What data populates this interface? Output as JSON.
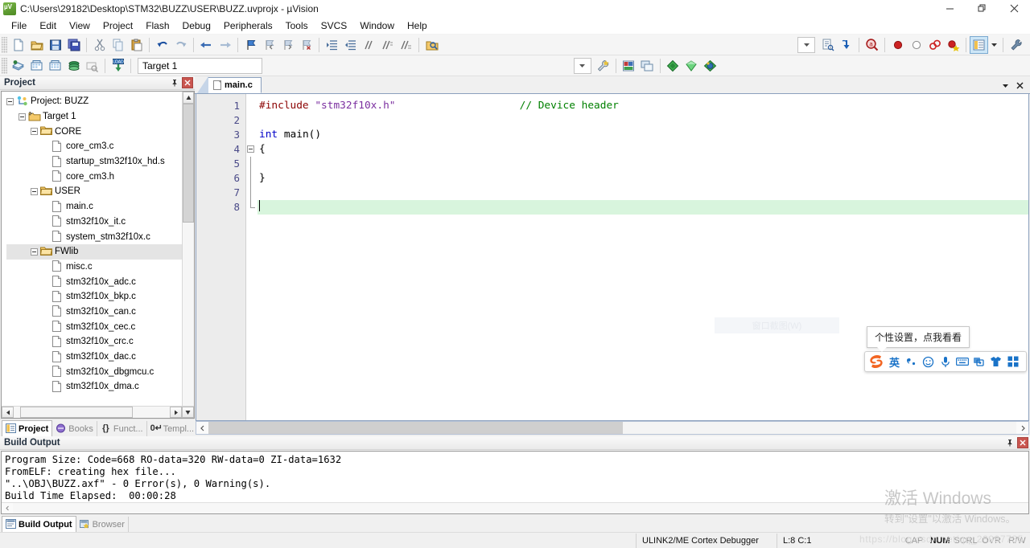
{
  "window": {
    "title": "C:\\Users\\29182\\Desktop\\STM32\\BUZZ\\USER\\BUZZ.uvprojx - µVision",
    "app_icon": "uvision-icon",
    "minimize": "–",
    "maximize": "❐",
    "close": "✕"
  },
  "menu": {
    "items": [
      {
        "label": "File"
      },
      {
        "label": "Edit"
      },
      {
        "label": "View"
      },
      {
        "label": "Project"
      },
      {
        "label": "Flash"
      },
      {
        "label": "Debug"
      },
      {
        "label": "Peripherals"
      },
      {
        "label": "Tools"
      },
      {
        "label": "SVCS"
      },
      {
        "label": "Window"
      },
      {
        "label": "Help"
      }
    ]
  },
  "toolbar_file": {
    "buttons": [
      {
        "name": "new-file-icon",
        "tip": "New"
      },
      {
        "name": "open-file-icon",
        "tip": "Open"
      },
      {
        "name": "save-icon",
        "tip": "Save"
      },
      {
        "name": "save-all-icon",
        "tip": "Save All"
      },
      {
        "name": "cut-icon",
        "tip": "Cut"
      },
      {
        "name": "copy-icon",
        "tip": "Copy"
      },
      {
        "name": "paste-icon",
        "tip": "Paste"
      },
      {
        "name": "undo-icon",
        "tip": "Undo"
      },
      {
        "name": "redo-icon",
        "tip": "Redo"
      },
      {
        "name": "back-arrow-icon",
        "tip": "Navigate Backwards"
      },
      {
        "name": "forward-arrow-icon",
        "tip": "Navigate Forwards"
      },
      {
        "name": "bookmark-toggle-icon",
        "tip": "Insert/Remove Bookmark"
      },
      {
        "name": "bookmark-prev-icon",
        "tip": "Previous Bookmark"
      },
      {
        "name": "bookmark-next-icon",
        "tip": "Next Bookmark"
      },
      {
        "name": "bookmark-clear-icon",
        "tip": "Clear All Bookmarks"
      },
      {
        "name": "indent-icon",
        "tip": "Indent"
      },
      {
        "name": "outdent-icon",
        "tip": "Outdent"
      },
      {
        "name": "comment-icon",
        "tip": "Comment"
      },
      {
        "name": "uncomment-icon",
        "tip": "Uncomment"
      },
      {
        "name": "uncomment2-icon",
        "tip": "Toggle Comment"
      },
      {
        "name": "find-in-files-icon",
        "tip": "Find in Files"
      }
    ],
    "right_buttons": [
      {
        "name": "configure-dropdown-icon",
        "tip": "Configuration"
      },
      {
        "name": "source-browse-icon",
        "tip": "Source Browse"
      },
      {
        "name": "insert-include-icon",
        "tip": "Insert Include"
      },
      {
        "name": "find-icon",
        "tip": "Find"
      },
      {
        "name": "breakpoint-icon",
        "tip": "Insert/Remove Breakpoint"
      },
      {
        "name": "breakpoint-disable-icon",
        "tip": "Enable/Disable Breakpoint"
      },
      {
        "name": "breakpoint-disable-all-icon",
        "tip": "Disable All Breakpoints"
      },
      {
        "name": "breakpoint-kill-all-icon",
        "tip": "Kill All Breakpoints"
      },
      {
        "name": "project-window-icon",
        "tip": "Project Window"
      },
      {
        "name": "dropdown-arrow-icon",
        "tip": "More"
      },
      {
        "name": "customize-tools-icon",
        "tip": "Customize Tools"
      }
    ]
  },
  "toolbar_build": {
    "buttons": [
      {
        "name": "translate-icon",
        "tip": "Translate"
      },
      {
        "name": "build-icon",
        "tip": "Build"
      },
      {
        "name": "rebuild-icon",
        "tip": "Rebuild"
      },
      {
        "name": "batch-build-icon",
        "tip": "Batch Build"
      },
      {
        "name": "stop-build-icon",
        "tip": "Stop Build"
      },
      {
        "name": "download-icon",
        "tip": "Download"
      }
    ],
    "target_combo": {
      "name": "target-selector",
      "value": "Target 1",
      "options": [
        "Target 1"
      ]
    },
    "after_combo": [
      {
        "name": "target-options-icon",
        "tip": "Target Options"
      },
      {
        "name": "manage-project-items-icon",
        "tip": "Manage Project Items"
      },
      {
        "name": "multi-project-icon",
        "tip": "Manage Multi-Project"
      },
      {
        "name": "components-icon",
        "tip": "Manage Run-Time Environment"
      },
      {
        "name": "pack-installer-icon",
        "tip": "Pack Installer"
      },
      {
        "name": "env-icon",
        "tip": "Environment"
      }
    ]
  },
  "project_panel": {
    "title": "Project",
    "pin_icon": "pin-icon",
    "close_icon": "close-icon",
    "tree": [
      {
        "label": "Project: BUZZ",
        "depth": 0,
        "type": "project",
        "expandable": true
      },
      {
        "label": "Target 1",
        "depth": 1,
        "type": "target",
        "expandable": true
      },
      {
        "label": "CORE",
        "depth": 2,
        "type": "folder",
        "expandable": true
      },
      {
        "label": "core_cm3.c",
        "depth": 3,
        "type": "file",
        "expandable": false
      },
      {
        "label": "startup_stm32f10x_hd.s",
        "depth": 3,
        "type": "file",
        "expandable": false
      },
      {
        "label": "core_cm3.h",
        "depth": 3,
        "type": "file",
        "expandable": false
      },
      {
        "label": "USER",
        "depth": 2,
        "type": "folder",
        "expandable": true
      },
      {
        "label": "main.c",
        "depth": 3,
        "type": "file",
        "expandable": false
      },
      {
        "label": "stm32f10x_it.c",
        "depth": 3,
        "type": "file",
        "expandable": false
      },
      {
        "label": "system_stm32f10x.c",
        "depth": 3,
        "type": "file",
        "expandable": false
      },
      {
        "label": "FWlib",
        "depth": 2,
        "type": "folder",
        "expandable": true,
        "selected": true
      },
      {
        "label": "misc.c",
        "depth": 3,
        "type": "file",
        "expandable": false
      },
      {
        "label": "stm32f10x_adc.c",
        "depth": 3,
        "type": "file",
        "expandable": false
      },
      {
        "label": "stm32f10x_bkp.c",
        "depth": 3,
        "type": "file",
        "expandable": false
      },
      {
        "label": "stm32f10x_can.c",
        "depth": 3,
        "type": "file",
        "expandable": false
      },
      {
        "label": "stm32f10x_cec.c",
        "depth": 3,
        "type": "file",
        "expandable": false
      },
      {
        "label": "stm32f10x_crc.c",
        "depth": 3,
        "type": "file",
        "expandable": false
      },
      {
        "label": "stm32f10x_dac.c",
        "depth": 3,
        "type": "file",
        "expandable": false
      },
      {
        "label": "stm32f10x_dbgmcu.c",
        "depth": 3,
        "type": "file",
        "expandable": false
      },
      {
        "label": "stm32f10x_dma.c",
        "depth": 3,
        "type": "file",
        "expandable": false
      }
    ],
    "tabs": [
      {
        "label": "Project",
        "icon": "project-tab-icon",
        "selected": true
      },
      {
        "label": "Books",
        "icon": "books-tab-icon",
        "selected": false
      },
      {
        "label": "Funct...",
        "icon": "functions-tab-icon",
        "selected": false
      },
      {
        "label": "Templ...",
        "icon": "templates-tab-icon",
        "selected": false
      }
    ]
  },
  "editor": {
    "tabs": [
      {
        "label": "main.c",
        "icon": "c-file-icon",
        "selected": true
      }
    ],
    "minimize_icon": "▼",
    "close_icon": "✕",
    "line_numbers": [
      "1",
      "2",
      "3",
      "4",
      "5",
      "6",
      "7",
      "8"
    ],
    "lines": [
      {
        "n": 1,
        "tokens": [
          {
            "t": "#include ",
            "c": "pre"
          },
          {
            "t": "\"stm32f10x.h\"",
            "c": "str"
          },
          {
            "t": "                    ",
            "c": "txt"
          },
          {
            "t": "// Device header",
            "c": "cmt"
          }
        ]
      },
      {
        "n": 2,
        "tokens": []
      },
      {
        "n": 3,
        "tokens": [
          {
            "t": "int",
            "c": "kw"
          },
          {
            "t": " main()",
            "c": "txt"
          }
        ]
      },
      {
        "n": 4,
        "tokens": [
          {
            "t": "{",
            "c": "txt"
          }
        ]
      },
      {
        "n": 5,
        "tokens": []
      },
      {
        "n": 6,
        "tokens": [
          {
            "t": "}",
            "c": "txt"
          }
        ]
      },
      {
        "n": 7,
        "tokens": []
      },
      {
        "n": 8,
        "tokens": [],
        "current": true,
        "caret": true
      }
    ]
  },
  "build_output": {
    "title": "Build Output",
    "pin_icon": "pin-icon",
    "close_icon": "close-icon",
    "text": "Program Size: Code=668 RO-data=320 RW-data=0 ZI-data=1632\nFromELF: creating hex file...\n\"..\\OBJ\\BUZZ.axf\" - 0 Error(s), 0 Warning(s).\nBuild Time Elapsed:  00:00:28",
    "tabs": [
      {
        "label": "Build Output",
        "icon": "build-output-tab-icon",
        "selected": true
      },
      {
        "label": "Browser",
        "icon": "browser-tab-icon",
        "selected": false
      }
    ]
  },
  "statusbar": {
    "debugger": "ULINK2/ME Cortex Debugger",
    "position": "L:8 C:1",
    "flags": [
      {
        "label": "CAP",
        "on": false
      },
      {
        "label": "NUM",
        "on": true
      },
      {
        "label": "SCRL",
        "on": false
      },
      {
        "label": "OVR",
        "on": false
      },
      {
        "label": "R/W",
        "on": false
      }
    ]
  },
  "overlays": {
    "ime": {
      "tooltip": "个性设置，点我看看",
      "logo": "S",
      "items": [
        {
          "name": "ime-mode-english-icon",
          "glyph": "英"
        },
        {
          "name": "ime-punctuation-icon",
          "glyph": "’,"
        },
        {
          "name": "ime-emoji-icon",
          "glyph": "☺"
        },
        {
          "name": "ime-voice-icon",
          "glyph": "⬤"
        },
        {
          "name": "ime-keyboard-icon",
          "glyph": "⌨"
        },
        {
          "name": "ime-toolbox-icon",
          "glyph": "❐"
        },
        {
          "name": "ime-skin-icon",
          "glyph": "☂"
        },
        {
          "name": "ime-apps-icon",
          "glyph": "▦"
        }
      ]
    },
    "ghost_snip": "窗口截图(W)",
    "windows_activation": {
      "title": "激活 Windows",
      "subtitle": "转到\"设置\"以激活 Windows。"
    },
    "watermark_url": "https://blog.csdn.net/qq_28997735"
  },
  "colors": {
    "accent": "#1a73c8",
    "current_line": "#d8f5dd",
    "comment": "#008000",
    "keyword": "#0000c8",
    "string": "#7b2fa0",
    "preprocessor": "#8b0000",
    "panel_close": "#c9554f"
  }
}
